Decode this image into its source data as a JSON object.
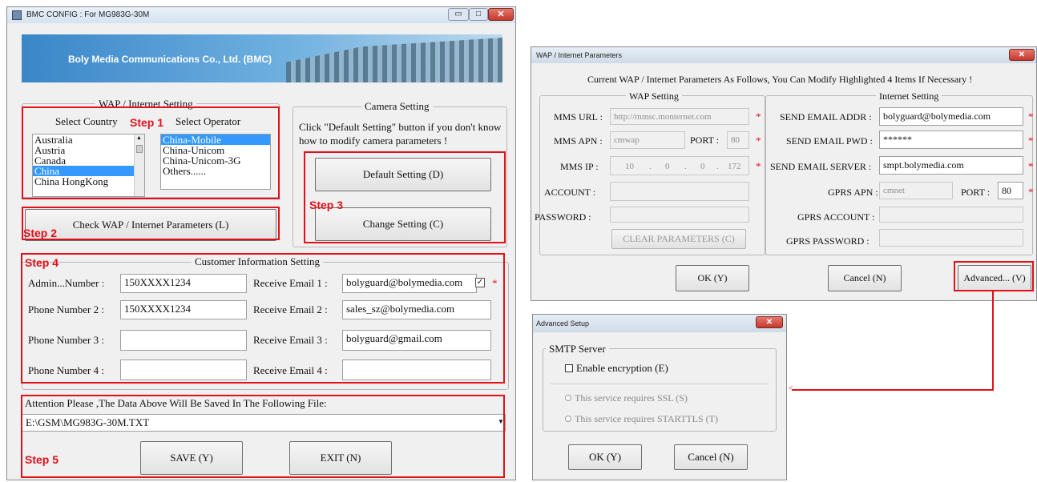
{
  "main_window": {
    "title": "BMC CONFIG : For MG983G-30M",
    "banner_text": "Boly Media Communications Co., Ltd. (BMC)",
    "wap_group_label": "WAP / Internet Setting",
    "select_country_label": "Select Country",
    "select_operator_label": "Select Operator",
    "countries": [
      "Australia",
      "Austria",
      "Canada",
      "China",
      "China HongKong"
    ],
    "operators": [
      "China-Mobile",
      "China-Unicom",
      "China-Unicom-3G",
      "Others......"
    ],
    "check_button": "Check WAP / Internet Parameters (L)",
    "camera_group_label": "Camera Setting",
    "camera_hint": "Click \"Default Setting\" button if you don't know how to modify camera parameters !",
    "default_button": "Default Setting (D)",
    "change_button": "Change Setting (C)",
    "customer_group_label": "Customer Information Setting",
    "phone_labels": [
      "Admin...Number :",
      "Phone Number 2 :",
      "Phone Number 3 :",
      "Phone Number 4 :"
    ],
    "phone_values": [
      "150XXXX1234",
      "150XXXX1234",
      "",
      ""
    ],
    "email_labels": [
      "Receive Email 1 :",
      "Receive Email 2 :",
      "Receive Email 3 :",
      "Receive Email 4 :"
    ],
    "email_values": [
      "bolyguard@bolymedia.com",
      "sales_sz@bolymedia.com",
      "bolyguard@gmail.com",
      ""
    ],
    "attention_text": "Attention Please ,The Data Above Will Be Saved In The Following  File:",
    "file_path": "E:\\GSM\\MG983G-30M.TXT",
    "save_button": "SAVE (Y)",
    "exit_button": "EXIT (N)",
    "steps": [
      "Step 1",
      "Step 2",
      "Step 3",
      "Step 4",
      "Step 5"
    ]
  },
  "wap_window": {
    "title": "WAP / Internet Parameters",
    "header_text": "Current WAP / Internet Parameters As Follows, You Can Modify Highlighted 4 Items If Necessary !",
    "wap_group_label": "WAP Setting",
    "internet_group_label": "Internet Setting",
    "mms_url_label": "MMS URL :",
    "mms_url_value": "http://mmsc.monternet.com",
    "mms_apn_label": "MMS APN :",
    "mms_apn_value": "cmwap",
    "port_label": "PORT :",
    "mms_port_value": "80",
    "mms_ip_label": "MMS IP :",
    "mms_ip_parts": [
      "10",
      "0",
      "0",
      "172"
    ],
    "account_label": "ACCOUNT :",
    "password_label": "PASSWORD :",
    "clear_button": "CLEAR PARAMETERS (C)",
    "send_email_addr_label": "SEND EMAIL ADDR :",
    "send_email_addr_value": "bolyguard@bolymedia.com",
    "send_email_pwd_label": "SEND EMAIL PWD :",
    "send_email_pwd_value": "******",
    "send_email_server_label": "SEND EMAIL SERVER :",
    "send_email_server_value": "smpt.bolymedia.com",
    "gprs_apn_label": "GPRS APN :",
    "gprs_apn_value": "cmnet",
    "gprs_port_value": "80",
    "gprs_account_label": "GPRS ACCOUNT :",
    "gprs_password_label": "GPRS PASSWORD :",
    "ok_button": "OK (Y)",
    "cancel_button": "Cancel (N)",
    "advanced_button": "Advanced... (V)"
  },
  "advanced_window": {
    "title": "Advanced Setup",
    "smtp_group_label": "SMTP Server",
    "enable_encryption": "Enable encryption (E)",
    "ssl_option": "This service requires SSL (S)",
    "starttls_option": "This service requires  STARTTLS (T)",
    "ok_button": "OK (Y)",
    "cancel_button": "Cancel (N)"
  },
  "colors": {
    "annotation_red": "#e3101a",
    "selection_blue": "#3399ff",
    "window_bg": "#f0f0f0"
  }
}
